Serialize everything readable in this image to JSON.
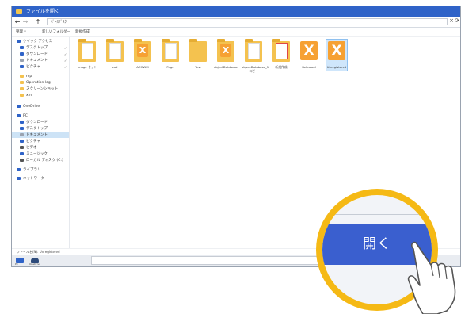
{
  "window": {
    "title": "ファイルを開く",
    "address": "ﾍﾞｰｽﾃﾞｽｸ",
    "toolbar": [
      "整理 ▾",
      "新しいフォルダー",
      "新規作成"
    ]
  },
  "sidebar": {
    "items": [
      {
        "label": "クイック アクセス",
        "icon": "star-icon",
        "color": "#2f63c8"
      },
      {
        "label": "デスクトップ",
        "icon": "desktop-icon",
        "color": "#2f63c8"
      },
      {
        "label": "ダウンロード",
        "icon": "download-icon",
        "color": "#2f63c8"
      },
      {
        "label": "ドキュメント",
        "icon": "documents-icon",
        "color": "#9aa3b0"
      },
      {
        "label": "ピクチャ",
        "icon": "pictures-icon",
        "color": "#2f63c8"
      },
      {
        "label": "mp",
        "icon": "folder-icon",
        "color": "#f4c24f"
      },
      {
        "label": "Operation log",
        "icon": "folder-icon",
        "color": "#f4c24f"
      },
      {
        "label": "スクリーンショット",
        "icon": "folder-icon",
        "color": "#f4c24f"
      },
      {
        "label": "xml",
        "icon": "folder-icon",
        "color": "#f4c24f"
      },
      {
        "label": "OneDrive",
        "icon": "cloud-icon",
        "color": "#2f63c8"
      },
      {
        "label": "PC",
        "icon": "pc-icon",
        "color": "#2f63c8"
      },
      {
        "label": "ダウンロード",
        "icon": "download-icon",
        "color": "#2f63c8"
      },
      {
        "label": "デスクトップ",
        "icon": "desktop-icon",
        "color": "#2f63c8"
      },
      {
        "label": "ドキュメント",
        "icon": "documents-icon",
        "color": "#9aa3b0"
      },
      {
        "label": "ピクチャ",
        "icon": "pictures-icon",
        "color": "#2f63c8"
      },
      {
        "label": "ビデオ",
        "icon": "video-icon",
        "color": "#555555"
      },
      {
        "label": "ミュージック",
        "icon": "music-icon",
        "color": "#2f63c8"
      },
      {
        "label": "ローカル ディスク (C:)",
        "icon": "disk-icon",
        "color": "#555555"
      },
      {
        "label": "ライブラリ",
        "icon": "library-icon",
        "color": "#2f63c8"
      },
      {
        "label": "ネットワーク",
        "icon": "network-icon",
        "color": "#2f63c8"
      }
    ]
  },
  "files": [
    {
      "name": "Image セット",
      "kind": "folder-doc"
    },
    {
      "name": "cad",
      "kind": "folder-doc"
    },
    {
      "name": "ACOWM",
      "kind": "folder-x"
    },
    {
      "name": "Page",
      "kind": "folder-doc"
    },
    {
      "name": "Test",
      "kind": "folder"
    },
    {
      "name": "objectDatabase",
      "kind": "folder-x"
    },
    {
      "name": "objectDatabase_1 コピー",
      "kind": "folder-doc"
    },
    {
      "name": "新規作成",
      "kind": "folder-doc"
    },
    {
      "name": "Released",
      "kind": "x-file"
    },
    {
      "name": "Unregistered",
      "kind": "x-file-selected"
    }
  ],
  "status": "ファイル名(N): Unregistered",
  "taskbar": {
    "items": [
      "PC",
      "OneDrive"
    ]
  },
  "callout": {
    "button_label": "開く"
  },
  "colors": {
    "accent": "#2f63c8",
    "highlight": "#f5b915",
    "button": "#3a5fcf"
  }
}
